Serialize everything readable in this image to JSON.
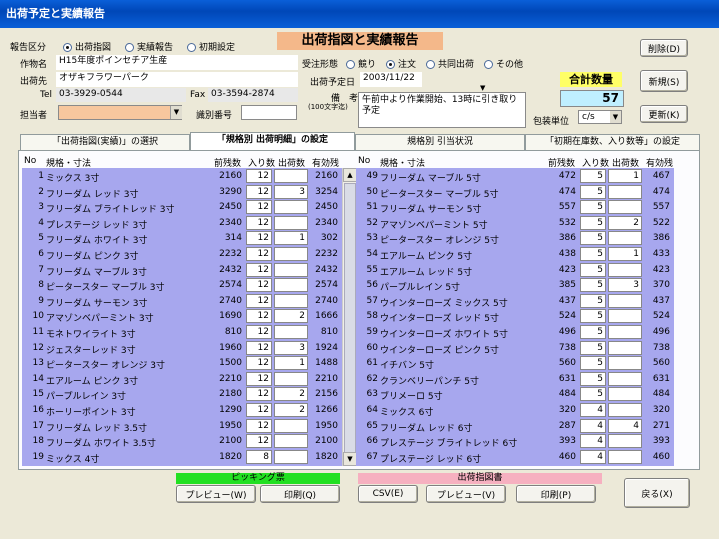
{
  "window": {
    "title": "出荷予定と実績報告"
  },
  "header": {
    "report_label": "報告区分",
    "report_options": [
      "出荷指図",
      "実績報告",
      "初期設定"
    ],
    "report_selected": 0,
    "main_title": "出荷指図と実績報告",
    "work_label": "作物名",
    "work_value": "H15年度ポインセチア生産",
    "dest_label": "出荷先",
    "dest_value": "オザキフラワーパーク",
    "tel_label": "Tel",
    "tel_value": "03-3929-0544",
    "fax_label": "Fax",
    "fax_value": "03-3594-2874",
    "person_label": "担当者",
    "person_value": "",
    "id_label": "識別番号",
    "id_value": "",
    "order_label": "受注形態",
    "order_options": [
      "競り",
      "注文",
      "共同出荷",
      "その他"
    ],
    "order_selected": 1,
    "date_label": "出荷予定日",
    "date_value": "2003/11/22",
    "note_label": "備　考",
    "note_sub": "(100文字迄)",
    "note_value": "午前中より作業開始、13時に引き取り予定",
    "total_label": "合計数量",
    "total_value": "57",
    "unit_label": "包装単位",
    "unit_value": "c/s"
  },
  "buttons": {
    "delete": "削除(D)",
    "new": "新規(S)",
    "update": "更新(K)",
    "back": "戻る(X)"
  },
  "tabs": [
    "「出荷指図(実績)」の選択",
    "「規格別 出荷明細」の設定",
    "規格別 引当状況",
    "「初期在庫数、入り数等」の設定"
  ],
  "table": {
    "headers": [
      "No",
      "規格・寸法",
      "前残数",
      "入り数",
      "出荷数",
      "有効残"
    ],
    "left": [
      [
        "1",
        "ミックス 3寸",
        "2160",
        "12",
        "",
        "2160"
      ],
      [
        "2",
        "フリーダム レッド 3寸",
        "3290",
        "12",
        "3",
        "3254"
      ],
      [
        "3",
        "フリーダム ブライトレッド 3寸",
        "2450",
        "12",
        "",
        "2450"
      ],
      [
        "4",
        "プレステージ レッド 3寸",
        "2340",
        "12",
        "",
        "2340"
      ],
      [
        "5",
        "フリーダム ホワイト 3寸",
        "314",
        "12",
        "1",
        "302"
      ],
      [
        "6",
        "フリーダム ピンク 3寸",
        "2232",
        "12",
        "",
        "2232"
      ],
      [
        "7",
        "フリーダム マーブル 3寸",
        "2432",
        "12",
        "",
        "2432"
      ],
      [
        "8",
        "ピータースター マーブル 3寸",
        "2574",
        "12",
        "",
        "2574"
      ],
      [
        "9",
        "フリーダム サーモン 3寸",
        "2740",
        "12",
        "",
        "2740"
      ],
      [
        "10",
        "アマゾンベパーミント 3寸",
        "1690",
        "12",
        "2",
        "1666"
      ],
      [
        "11",
        "モネトワイライト 3寸",
        "810",
        "12",
        "",
        "810"
      ],
      [
        "12",
        "ジェスターレッド 3寸",
        "1960",
        "12",
        "3",
        "1924"
      ],
      [
        "13",
        "ピータースター オレンジ 3寸",
        "1500",
        "12",
        "1",
        "1488"
      ],
      [
        "14",
        "エアルーム ピンク 3寸",
        "2210",
        "12",
        "",
        "2210"
      ],
      [
        "15",
        "パープルレイン 3寸",
        "2180",
        "12",
        "2",
        "2156"
      ],
      [
        "16",
        "ホーリーポイント 3寸",
        "1290",
        "12",
        "2",
        "1266"
      ],
      [
        "17",
        "フリーダム レッド 3.5寸",
        "1950",
        "12",
        "",
        "1950"
      ],
      [
        "18",
        "フリーダム ホワイト 3.5寸",
        "2100",
        "12",
        "",
        "2100"
      ],
      [
        "19",
        "ミックス 4寸",
        "1820",
        "8",
        "",
        "1820"
      ]
    ],
    "right": [
      [
        "49",
        "フリーダム マーブル 5寸",
        "472",
        "5",
        "1",
        "467"
      ],
      [
        "50",
        "ピータースター マーブル 5寸",
        "474",
        "5",
        "",
        "474"
      ],
      [
        "51",
        "フリーダム サーモン 5寸",
        "557",
        "5",
        "",
        "557"
      ],
      [
        "52",
        "アマゾンベパーミント 5寸",
        "532",
        "5",
        "2",
        "522"
      ],
      [
        "53",
        "ピータースター オレンジ 5寸",
        "386",
        "5",
        "",
        "386"
      ],
      [
        "54",
        "エアルーム ピンク 5寸",
        "438",
        "5",
        "1",
        "433"
      ],
      [
        "55",
        "エアルーム レッド 5寸",
        "423",
        "5",
        "",
        "423"
      ],
      [
        "56",
        "パープルレイン 5寸",
        "385",
        "5",
        "3",
        "370"
      ],
      [
        "57",
        "ウインターローズ ミックス 5寸",
        "437",
        "5",
        "",
        "437"
      ],
      [
        "58",
        "ウインターローズ レッド 5寸",
        "524",
        "5",
        "",
        "524"
      ],
      [
        "59",
        "ウインターローズ ホワイト 5寸",
        "496",
        "5",
        "",
        "496"
      ],
      [
        "60",
        "ウインターローズ ピンク 5寸",
        "738",
        "5",
        "",
        "738"
      ],
      [
        "61",
        "イチバン 5寸",
        "560",
        "5",
        "",
        "560"
      ],
      [
        "62",
        "クランベリーパンチ 5寸",
        "631",
        "5",
        "",
        "631"
      ],
      [
        "63",
        "ブリメーロ 5寸",
        "484",
        "5",
        "",
        "484"
      ],
      [
        "64",
        "ミックス 6寸",
        "320",
        "4",
        "",
        "320"
      ],
      [
        "65",
        "フリーダム レッド 6寸",
        "287",
        "4",
        "4",
        "271"
      ],
      [
        "66",
        "プレステージ ブライトレッド 6寸",
        "393",
        "4",
        "",
        "393"
      ],
      [
        "67",
        "プレステージ レッド 6寸",
        "460",
        "4",
        "",
        "460"
      ]
    ]
  },
  "footer": {
    "picking_label": "ピッキング票",
    "picking_preview": "プレビュー(W)",
    "picking_print": "印刷(Q)",
    "order_doc_label": "出荷指図書",
    "csv": "CSV(E)",
    "doc_preview": "プレビュー(V)",
    "doc_print": "印刷(P)"
  }
}
